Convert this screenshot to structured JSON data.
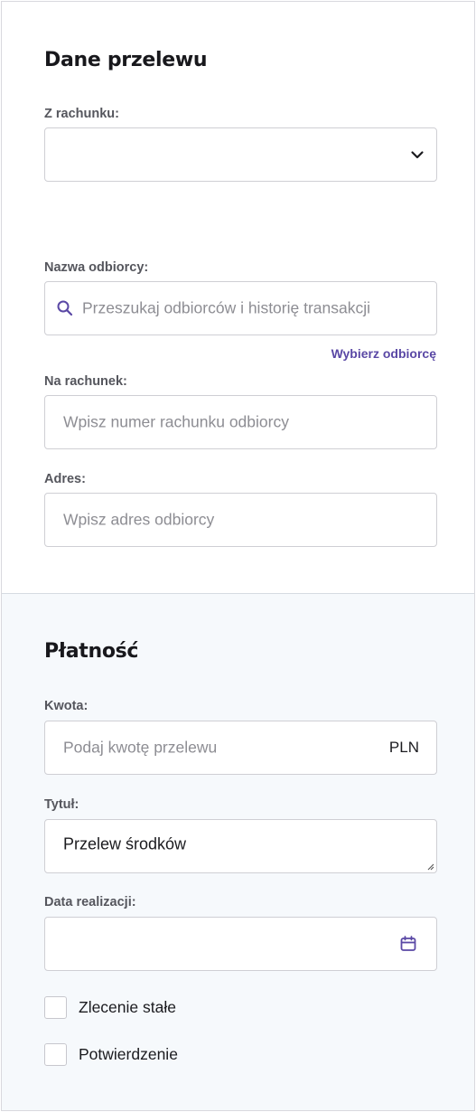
{
  "transfer": {
    "heading": "Dane przelewu",
    "from_account_label": "Z rachunku:",
    "from_account_value": "",
    "recipient_name_label": "Nazwa odbiorcy:",
    "recipient_search_placeholder": "Przeszukaj odbiorców i historię transakcji",
    "choose_recipient_link": "Wybierz odbiorcę",
    "to_account_label": "Na rachunek:",
    "to_account_placeholder": "Wpisz numer rachunku odbiorcy",
    "address_label": "Adres:",
    "address_placeholder": "Wpisz adres odbiorcy"
  },
  "payment": {
    "heading": "Płatność",
    "amount_label": "Kwota:",
    "amount_placeholder": "Podaj kwotę przelewu",
    "currency": "PLN",
    "title_label": "Tytuł:",
    "title_value": "Przelew środków",
    "date_label": "Data realizacji:",
    "date_value": "",
    "standing_order_label": "Zlecenie stałe",
    "confirmation_label": "Potwierdzenie"
  },
  "colors": {
    "accent": "#5a48a5",
    "section_bg": "#f6f9fc",
    "border": "#cfcfd4"
  },
  "icons": {
    "dropdown": "chevron-down-icon",
    "search": "search-icon",
    "date": "calendar-icon",
    "resize": "resize-handle-icon"
  }
}
